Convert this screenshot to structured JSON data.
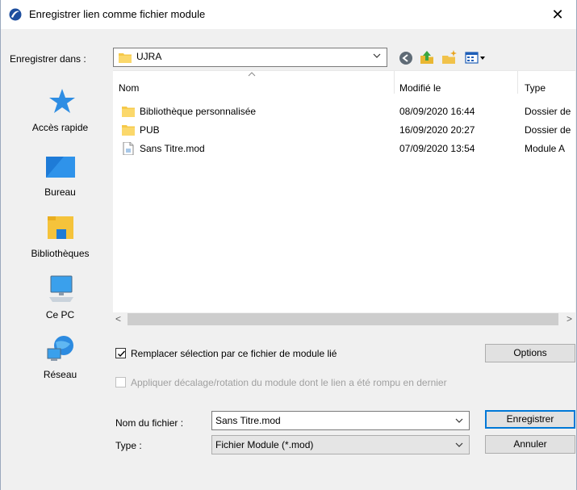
{
  "window": {
    "title": "Enregistrer lien comme fichier module",
    "close_glyph": "✕"
  },
  "location": {
    "label": "Enregistrer dans :",
    "current_folder": "UJRA"
  },
  "toolbar": {
    "icons": [
      "back-icon",
      "up-folder-icon",
      "new-folder-icon",
      "view-menu-icon"
    ]
  },
  "places": [
    {
      "label": "Accès rapide",
      "icon": "quick-access-star-icon"
    },
    {
      "label": "Bureau",
      "icon": "desktop-icon"
    },
    {
      "label": "Bibliothèques",
      "icon": "libraries-icon"
    },
    {
      "label": "Ce PC",
      "icon": "computer-icon"
    },
    {
      "label": "Réseau",
      "icon": "network-icon"
    }
  ],
  "columns": {
    "name": "Nom",
    "modified": "Modifié le",
    "type": "Type"
  },
  "files": [
    {
      "name": "Bibliothèque personnalisée",
      "modified": "08/09/2020 16:44",
      "type": "Dossier de",
      "kind": "folder"
    },
    {
      "name": "PUB",
      "modified": "16/09/2020 20:27",
      "type": "Dossier de",
      "kind": "folder"
    },
    {
      "name": "Sans Titre.mod",
      "modified": "07/09/2020 13:54",
      "type": "Module A",
      "kind": "file"
    }
  ],
  "scroll": {
    "left_arrow": "<",
    "right_arrow": ">"
  },
  "options": {
    "replace_label": "Remplacer sélection par ce fichier de module lié",
    "replace_checked": true,
    "offset_label": "Appliquer décalage/rotation du module dont le lien a été rompu en dernier",
    "offset_checked": false,
    "offset_enabled": false,
    "options_button": "Options"
  },
  "filename": {
    "label": "Nom du fichier :",
    "value": "Sans Titre.mod"
  },
  "filetype": {
    "label": "Type :",
    "value": "Fichier Module (*.mod)"
  },
  "buttons": {
    "save": "Enregistrer",
    "cancel": "Annuler"
  },
  "colors": {
    "accent": "#0078d7",
    "folder": "#f6c94a",
    "disabled_text": "#a0a0a0"
  }
}
